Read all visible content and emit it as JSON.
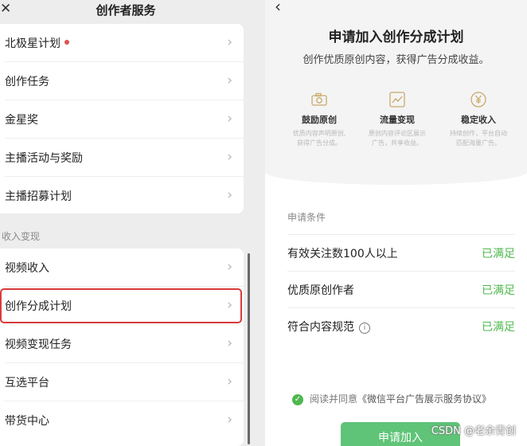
{
  "left": {
    "close_glyph": "✕",
    "title": "创作者服务",
    "group1": [
      {
        "label": "北极星计划",
        "dot": true
      },
      {
        "label": "创作任务"
      },
      {
        "label": "金星奖"
      },
      {
        "label": "主播活动与奖励"
      },
      {
        "label": "主播招募计划"
      }
    ],
    "section_label": "收入变现",
    "group2": [
      {
        "label": "视频收入"
      },
      {
        "label": "创作分成计划"
      },
      {
        "label": "视频变现任务"
      },
      {
        "label": "互选平台"
      },
      {
        "label": "带货中心"
      }
    ],
    "chevron": "›",
    "highlight_color": "#d93a3a"
  },
  "right": {
    "back_glyph": "‹",
    "title": "申请加入创作分成计划",
    "subtitle": "创作优质原创内容，获得广告分成收益。",
    "features": [
      {
        "icon": "camera-icon",
        "name": "鼓励原创",
        "desc": "优质内容声明原创,\n获得广告分成。"
      },
      {
        "icon": "chart-icon",
        "name": "流量变现",
        "desc": "原创内容评论区展示\n广告，共享收益。"
      },
      {
        "icon": "yen-icon",
        "name": "稳定收入",
        "desc": "持续创作，平台自动\n匹配海量广告。"
      }
    ],
    "conditions_label": "申请条件",
    "conditions": [
      {
        "text": "有效关注数100人以上",
        "status": "已满足"
      },
      {
        "text": "优质原创作者",
        "status": "已满足"
      },
      {
        "text": "符合内容规范",
        "status": "已满足",
        "info": "i"
      }
    ],
    "agree_check": "✓",
    "agree_text": "阅读并同意",
    "agree_link": "《微信平台广告展示服务协议》",
    "apply_label": "申请加入",
    "accent_color": "#4fb84f"
  },
  "watermark": "CSDN @老余青创"
}
